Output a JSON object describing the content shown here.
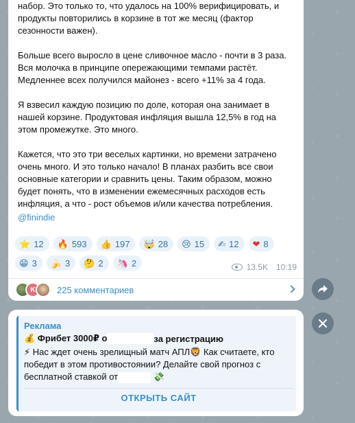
{
  "post": {
    "paragraphs": [
      "набор. Это только то, что удалось на 100% верифицировать, и продукты повторились в корзине в тот же месяц (фактор сезонности важен).",
      "Больше всего выросло в цене сливочное масло - почти в 3 раза. Вся молочка в принципе опережающими темпами растёт. Медленнее всех получился майонез - всего +11% за 4 года.",
      "Я взвесил каждую позицию по доле, которая она занимает в нашей корзине. Продуктовая инфляция вышла 12,5% в год на этом промежутке. Это много.",
      "Кажется, что это три веселых картинки, но времени затрачено очень много. И это только начало! В планах разбить все свои основные категории и сравнить цены. Таким образом, можно будет понять, что в изменении ежемесячных расходов есть инфляция, а что - рост объемов и/или качества потребления."
    ],
    "author_link": "@finindie",
    "reactions": [
      {
        "emoji": "⭐",
        "count": "12"
      },
      {
        "emoji": "🔥",
        "count": "593"
      },
      {
        "emoji": "👍",
        "count": "197"
      },
      {
        "emoji": "🤯",
        "count": "28"
      },
      {
        "emoji": "😢",
        "count": "15"
      },
      {
        "emoji": "✍",
        "count": "12"
      },
      {
        "emoji": "❤",
        "count": "8"
      },
      {
        "emoji": "😁",
        "count": "3"
      },
      {
        "emoji": "🍌",
        "count": "3"
      },
      {
        "emoji": "🤔",
        "count": "2"
      },
      {
        "emoji": "🦄",
        "count": "2"
      }
    ],
    "views": "13.5K",
    "time": "10:19",
    "comments": {
      "avatar_letter": "K",
      "label": "225 комментариев"
    }
  },
  "ad": {
    "label": "Реклама",
    "title_before": "💰 Фрибет 3000₽ о",
    "title_after": "за регистрацию",
    "text_before": "⚡ Нас ждет очень зрелищный матч АПЛ🦁 Как считаете, кто победит в этом противостоянии? Делайте свой прогноз с бесплатной ставкой от",
    "text_after": " 💸",
    "button": "ОТКРЫТЬ САЙТ"
  },
  "colors": {
    "accent": "#3a8fc7",
    "reaction_bg": "#eaf2f9",
    "background": "#9aa6ad"
  }
}
